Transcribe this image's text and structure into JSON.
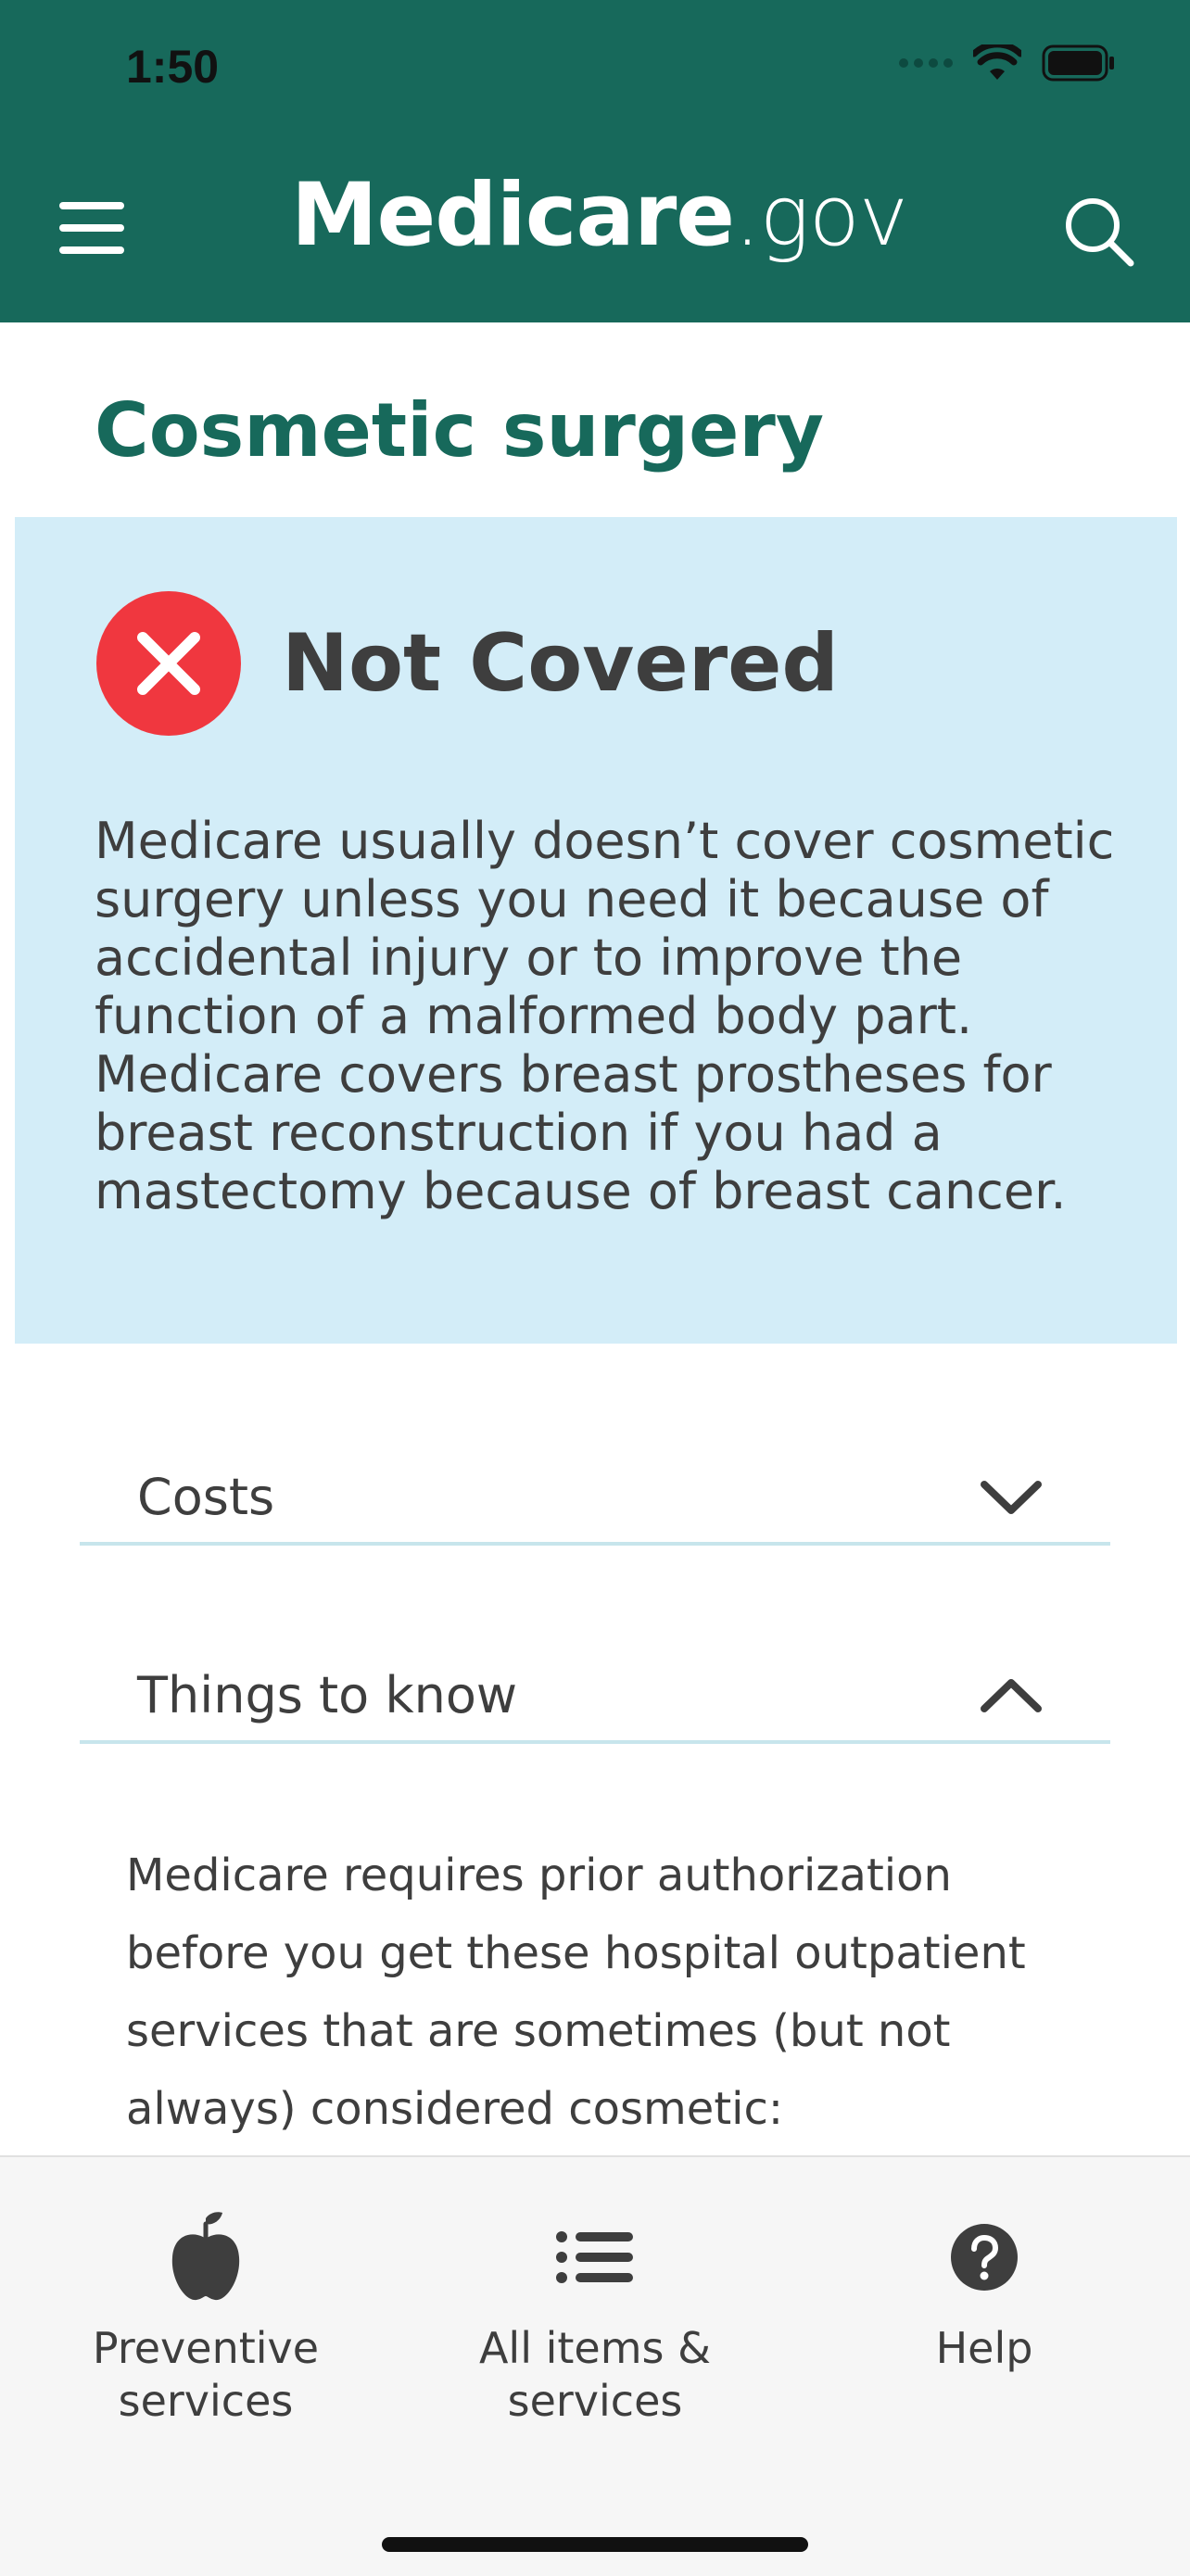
{
  "status_bar": {
    "time": "1:50",
    "icons": [
      "cellular-signal-icon",
      "wifi-icon",
      "battery-icon"
    ]
  },
  "header": {
    "brand_main": "Medicare",
    "brand_suffix": ".gov",
    "menu_icon": "hamburger-menu-icon",
    "search_icon": "search-icon",
    "background_color": "#17695b"
  },
  "page": {
    "title": "Cosmetic surgery"
  },
  "coverage": {
    "status": "Not Covered",
    "status_icon": "x-circle-icon",
    "status_color": "#f0373f",
    "card_color": "#d3edf8",
    "description": "Medicare usually doesn’t cover cosmetic surgery unless you need it because of accidental injury or to improve the function of a malformed body part. Medicare covers breast prostheses for breast reconstruction if you had a mastectomy because of breast cancer."
  },
  "accordions": [
    {
      "label": "Costs",
      "expanded": false,
      "icon": "chevron-down-icon"
    },
    {
      "label": "Things to know",
      "expanded": true,
      "icon": "chevron-up-icon",
      "content": "Medicare requires prior authorization before you get these hospital outpatient services that are sometimes (but not always) considered cosmetic:"
    }
  ],
  "tab_bar": {
    "tabs": [
      {
        "label": "Preventive services",
        "icon": "apple-icon"
      },
      {
        "label": "All items & services",
        "icon": "list-icon"
      },
      {
        "label": "Help",
        "icon": "question-circle-icon"
      }
    ]
  }
}
